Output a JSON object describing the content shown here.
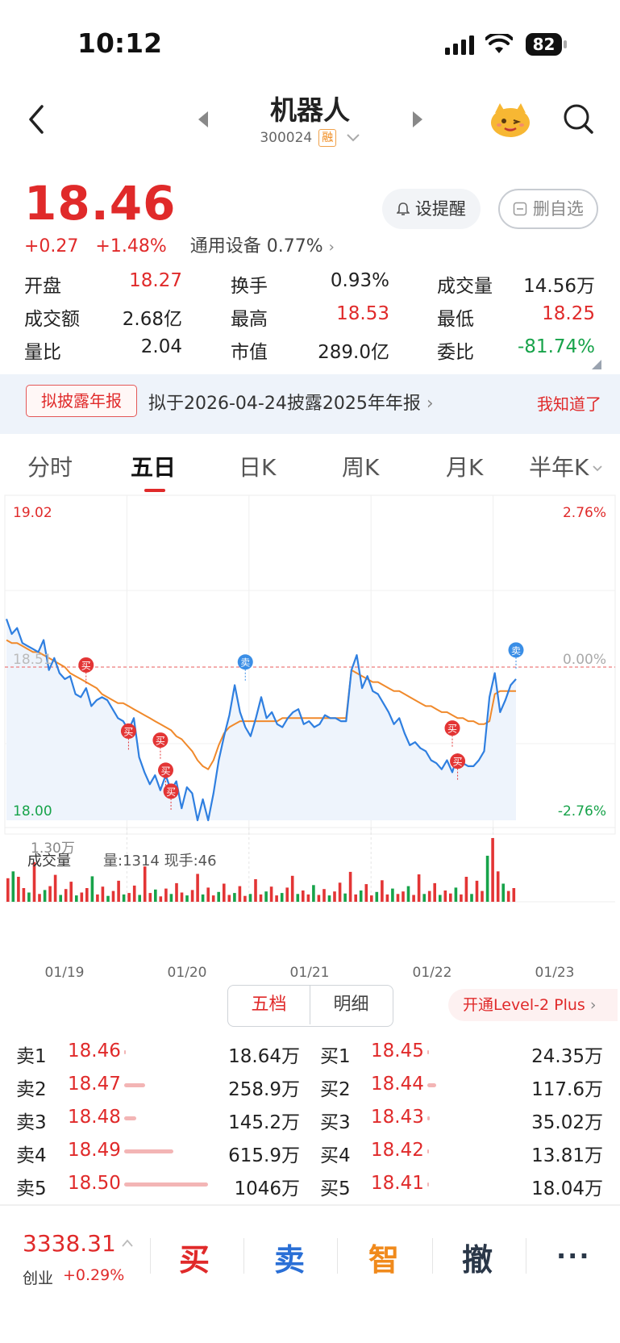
{
  "status_bar": {
    "time": "10:12",
    "battery": "82"
  },
  "header": {
    "title": "机器人",
    "code": "300024",
    "margin_badge": "融"
  },
  "quote": {
    "price": "18.46",
    "change": "+0.27",
    "change_pct": "+1.48%",
    "sector": "通用设备",
    "sector_pct": "0.77%",
    "alert_button": "设提醒",
    "remove_fav_button": "删自选",
    "stats": [
      {
        "label": "开盘",
        "value": "18.27",
        "color": "red"
      },
      {
        "label": "换手",
        "value": "0.93%",
        "color": "black"
      },
      {
        "label": "成交量",
        "value": "14.56万",
        "color": "black"
      },
      {
        "label": "成交额",
        "value": "2.68亿",
        "color": "black"
      },
      {
        "label": "最高",
        "value": "18.53",
        "color": "red"
      },
      {
        "label": "最低",
        "value": "18.25",
        "color": "red"
      },
      {
        "label": "量比",
        "value": "2.04",
        "color": "black"
      },
      {
        "label": "市值",
        "value": "289.0亿",
        "color": "black"
      },
      {
        "label": "委比",
        "value": "-81.74%",
        "color": "green"
      }
    ]
  },
  "notice": {
    "tag": "拟披露年报",
    "text": "拟于2026-04-24披露2025年年报",
    "dismiss": "我知道了"
  },
  "tabs": [
    "分时",
    "五日",
    "日K",
    "周K",
    "月K",
    "半年K"
  ],
  "active_tab": "五日",
  "chart_data": {
    "type": "line",
    "y_axis_left": {
      "top": "19.02",
      "mid": "18.51",
      "bottom": "18.00"
    },
    "y_axis_right": {
      "top": "2.76%",
      "mid": "0.00%",
      "bottom": "-2.76%"
    },
    "ylim": [
      18.0,
      19.02
    ],
    "reference_price": 18.51,
    "x_labels": [
      "01/19",
      "01/20",
      "01/21",
      "01/22",
      "01/23"
    ],
    "series": [
      {
        "color": "#2f7fe0",
        "values": [
          18.67,
          18.62,
          18.64,
          18.59,
          18.58,
          18.57,
          18.56,
          18.6,
          18.5,
          18.54,
          18.49,
          18.47,
          18.48,
          18.42,
          18.41,
          18.44,
          18.38,
          18.4,
          18.41,
          18.4,
          18.37,
          18.34,
          18.33,
          18.3,
          18.34,
          18.21,
          18.16,
          18.12,
          18.15,
          18.1,
          18.15,
          18.1,
          18.13,
          18.04,
          18.11,
          18.09,
          18.0,
          18.07,
          18.0,
          18.09,
          18.2,
          18.28,
          18.35,
          18.45,
          18.36,
          18.31,
          18.28,
          18.34,
          18.41,
          18.34,
          18.36,
          18.32,
          18.31,
          18.34,
          18.36,
          18.37,
          18.32,
          18.33,
          18.31,
          18.32,
          18.35,
          18.34,
          18.34,
          18.33,
          18.33,
          18.5,
          18.55,
          18.44,
          18.48,
          18.43,
          18.42,
          18.39,
          18.36,
          18.32,
          18.34,
          18.29,
          18.25,
          18.26,
          18.24,
          18.23,
          18.2,
          18.19,
          18.17,
          18.2,
          18.16,
          18.22,
          18.19,
          18.18,
          18.18,
          18.2,
          18.23,
          18.41,
          18.49,
          18.36,
          18.4,
          18.45,
          18.47
        ]
      },
      {
        "color": "#f0892b",
        "values": [
          18.6,
          18.59,
          18.59,
          18.58,
          18.57,
          18.56,
          18.56,
          18.55,
          18.54,
          18.53,
          18.52,
          18.51,
          18.49,
          18.48,
          18.47,
          18.46,
          18.45,
          18.44,
          18.42,
          18.41,
          18.4,
          18.39,
          18.39,
          18.38,
          18.37,
          18.36,
          18.35,
          18.34,
          18.33,
          18.32,
          18.31,
          18.3,
          18.28,
          18.27,
          18.25,
          18.23,
          18.2,
          18.18,
          18.17,
          18.2,
          18.25,
          18.29,
          18.31,
          18.32,
          18.33,
          18.33,
          18.33,
          18.33,
          18.33,
          18.33,
          18.33,
          18.33,
          18.34,
          18.34,
          18.34,
          18.34,
          18.34,
          18.34,
          18.34,
          18.34,
          18.34,
          18.34,
          18.34,
          18.34,
          18.34,
          18.5,
          18.49,
          18.48,
          18.47,
          18.46,
          18.46,
          18.45,
          18.44,
          18.43,
          18.43,
          18.42,
          18.41,
          18.4,
          18.39,
          18.38,
          18.38,
          18.37,
          18.36,
          18.36,
          18.35,
          18.34,
          18.34,
          18.33,
          18.33,
          18.32,
          18.32,
          18.33,
          18.42,
          18.43,
          18.43,
          18.43,
          18.43
        ]
      }
    ],
    "markers": [
      {
        "label": "买",
        "index": 15,
        "price": 18.49
      },
      {
        "label": "买",
        "index": 23,
        "price": 18.27
      },
      {
        "label": "买",
        "index": 29,
        "price": 18.24
      },
      {
        "label": "买",
        "index": 30,
        "price": 18.14
      },
      {
        "label": "买",
        "index": 31,
        "price": 18.07
      },
      {
        "label": "卖",
        "index": 45,
        "price": 18.5
      },
      {
        "label": "买",
        "index": 84,
        "price": 18.28
      },
      {
        "label": "买",
        "index": 85,
        "price": 18.17
      },
      {
        "label": "卖",
        "index": 96,
        "price": 18.54
      }
    ],
    "volume": {
      "title": "成交量",
      "info": "量:1314 现手:46",
      "max_label": "1.30万",
      "max_value": 13000,
      "bars": [
        4800,
        6200,
        5100,
        2800,
        1900,
        8100,
        1600,
        2400,
        3200,
        5500,
        1400,
        2600,
        4100,
        1300,
        1900,
        2800,
        5200,
        1500,
        3100,
        1200,
        2200,
        4300,
        1500,
        1800,
        3300,
        1400,
        7200,
        1800,
        2500,
        1100,
        2700,
        1600,
        3800,
        1900,
        1300,
        2400,
        5700,
        1500,
        2900,
        1300,
        2000,
        3700,
        1400,
        1800,
        3200,
        1200,
        1600,
        4600,
        1500,
        2100,
        3100,
        1300,
        1800,
        2900,
        5300,
        1600,
        2300,
        1500,
        3400,
        1400,
        2600,
        1300,
        2100,
        3900,
        1700,
        6100,
        1500,
        2300,
        3600,
        1300,
        2000,
        4400,
        1500,
        2700,
        1600,
        2100,
        3200,
        1400,
        5600,
        1600,
        2200,
        3800,
        1400,
        2300,
        1700,
        2900,
        1500,
        5100,
        1600,
        4300,
        2200,
        9400,
        13000,
        6200,
        3700,
        2200,
        2800
      ],
      "colors_pattern": "alternating red/green"
    }
  },
  "order_book": {
    "tabs": [
      "五档",
      "明细"
    ],
    "level2": "开通Level-2 Plus",
    "asks": [
      {
        "label": "卖1",
        "price": "18.46",
        "volume": "18.64万",
        "bar": 0.018
      },
      {
        "label": "卖2",
        "price": "18.47",
        "volume": "258.9万",
        "bar": 0.25
      },
      {
        "label": "卖3",
        "price": "18.48",
        "volume": "145.2万",
        "bar": 0.14
      },
      {
        "label": "卖4",
        "price": "18.49",
        "volume": "615.9万",
        "bar": 0.59
      },
      {
        "label": "卖5",
        "price": "18.50",
        "volume": "1046万",
        "bar": 1.0
      }
    ],
    "bids": [
      {
        "label": "买1",
        "price": "18.45",
        "volume": "24.35万",
        "bar": 0.02
      },
      {
        "label": "买2",
        "price": "18.44",
        "volume": "117.6万",
        "bar": 0.11
      },
      {
        "label": "买3",
        "price": "18.43",
        "volume": "35.02万",
        "bar": 0.03
      },
      {
        "label": "买4",
        "price": "18.42",
        "volume": "13.81万",
        "bar": 0.013
      },
      {
        "label": "买5",
        "price": "18.41",
        "volume": "18.04万",
        "bar": 0.017
      }
    ]
  },
  "bottom_bar": {
    "index_value": "3338.31",
    "index_name": "创业",
    "index_pct": "+0.29%",
    "buy": "买",
    "sell": "卖",
    "smart": "智",
    "cancel": "撤",
    "more": "···"
  },
  "colors": {
    "up": "#e02a2a",
    "down": "#17a34a",
    "price_line": "#2f7fe0",
    "avg_line": "#f0892b",
    "smart": "#f08a1c",
    "sell": "#2a6fd6"
  }
}
